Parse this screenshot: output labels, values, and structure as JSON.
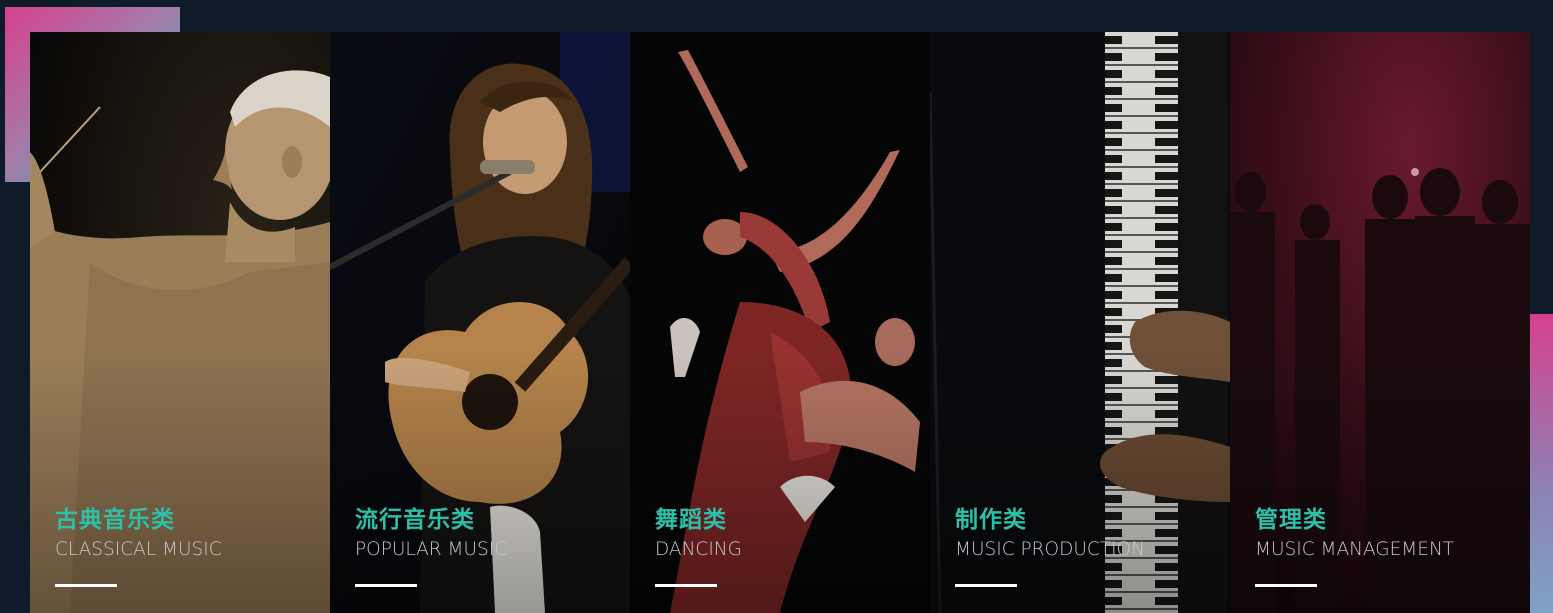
{
  "colors": {
    "page_background": "#101b2a",
    "title_accent": "#2dbfa8",
    "subtitle": "#c6c8cc",
    "underline": "#ffffff",
    "corner_gradient_pink": "#d6408e",
    "corner_gradient_teal": "#2fb7b0"
  },
  "categories": [
    {
      "title_cn": "古典音乐类",
      "title_en": "CLASSICAL MUSIC",
      "image": "orchestra-conductor-photo"
    },
    {
      "title_cn": "流行音乐类",
      "title_en": "POPULAR MUSIC",
      "image": "singer-with-guitar-photo"
    },
    {
      "title_cn": "舞蹈类",
      "title_en": "DANCING",
      "image": "dancers-photo"
    },
    {
      "title_cn": "制作类",
      "title_en": "MUSIC PRODUCTION",
      "image": "piano-keyboard-photo"
    },
    {
      "title_cn": "管理类",
      "title_en": "MUSIC MANAGEMENT",
      "image": "stage-crowd-silhouette-photo"
    }
  ]
}
